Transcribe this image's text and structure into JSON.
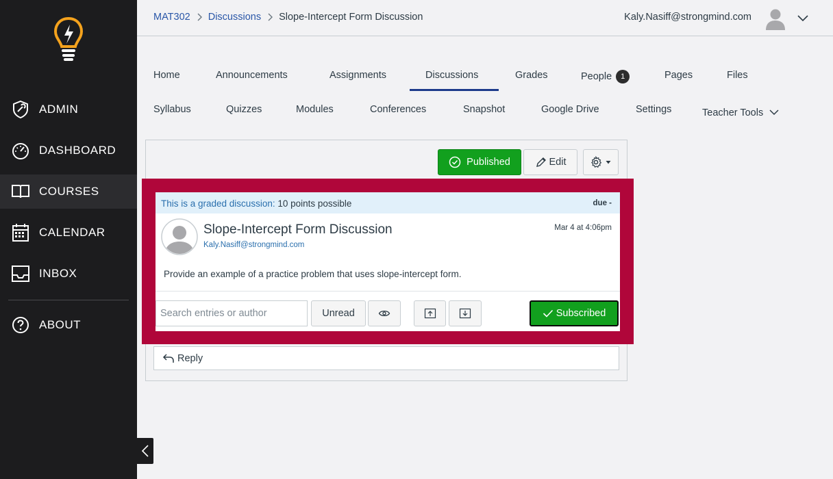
{
  "sidebar": {
    "items": [
      {
        "label": "ADMIN",
        "icon": "admin-shield-icon"
      },
      {
        "label": "DASHBOARD",
        "icon": "speedometer-icon"
      },
      {
        "label": "COURSES",
        "icon": "book-icon",
        "active": true
      },
      {
        "label": "CALENDAR",
        "icon": "calendar-icon"
      },
      {
        "label": "INBOX",
        "icon": "inbox-icon"
      },
      {
        "label": "ABOUT",
        "icon": "question-icon"
      }
    ]
  },
  "header": {
    "breadcrumb": [
      "MAT302",
      "Discussions",
      "Slope-Intercept Form Discussion"
    ],
    "user_email": "Kaly.Nasiff@strongmind.com"
  },
  "course_nav": {
    "row1": [
      "Home",
      "Announcements",
      "Assignments",
      "Discussions",
      "Grades",
      "People",
      "Pages",
      "Files"
    ],
    "people_badge": "1",
    "row2": [
      "Syllabus",
      "Quizzes",
      "Modules",
      "Conferences",
      "Snapshot",
      "Google Drive",
      "Settings",
      "Teacher Tools"
    ],
    "active": "Discussions"
  },
  "toolbar": {
    "published_label": "Published",
    "edit_label": "Edit"
  },
  "discussion": {
    "graded_text": "This is a graded discussion:",
    "points_text": "10 points possible",
    "due_text": "due -",
    "title": "Slope-Intercept Form Discussion",
    "author": "Kaly.Nasiff@strongmind.com",
    "date": "Mar 4 at 4:06pm",
    "body": "Provide an example of a practice problem that uses slope-intercept form."
  },
  "controls": {
    "search_placeholder": "Search entries or author",
    "unread_label": "Unread",
    "subscribed_label": "Subscribed"
  },
  "reply": {
    "label": "Reply"
  },
  "colors": {
    "sidebar_bg": "#1c1c1e",
    "link": "#2a57a8",
    "published_green": "#12a01e",
    "highlight_red": "#b0063a",
    "active_tab": "#1d3b8b"
  }
}
